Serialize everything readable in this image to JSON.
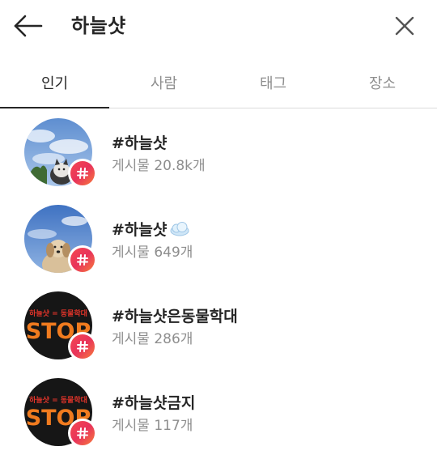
{
  "search": {
    "query": "하늘샷"
  },
  "tabs": [
    {
      "label": "인기",
      "active": true
    },
    {
      "label": "사람",
      "active": false
    },
    {
      "label": "태그",
      "active": false
    },
    {
      "label": "장소",
      "active": false
    }
  ],
  "results": [
    {
      "tag": "#하늘샷",
      "emoji": "",
      "count_prefix": "게시물",
      "count": "20.8k개",
      "avatar": "sky-cat"
    },
    {
      "tag": "#하늘샷",
      "emoji": "cloud-icon",
      "count_prefix": "게시물",
      "count": "649개",
      "avatar": "sky-dog"
    },
    {
      "tag": "#하늘샷은동물학대",
      "emoji": "",
      "count_prefix": "게시물",
      "count": "286개",
      "avatar": "stop-sign"
    },
    {
      "tag": "#하늘샷금지",
      "emoji": "",
      "count_prefix": "게시물",
      "count": "117개",
      "avatar": "stop-sign"
    }
  ],
  "avatar_text": {
    "top": "하늘샷 = 동물학대",
    "stop": "STOP"
  },
  "colors": {
    "text": "#262626",
    "secondary": "#8e8e8e",
    "divider": "#dbdbdb",
    "badge_gradient_start": "#f5484f",
    "badge_gradient_end": "#f77c3c",
    "stop_orange": "#f07b1f",
    "stop_red": "#e0342a"
  },
  "icons": {
    "back": "arrow-left-icon",
    "clear": "close-icon",
    "badge": "hashtag-icon"
  }
}
